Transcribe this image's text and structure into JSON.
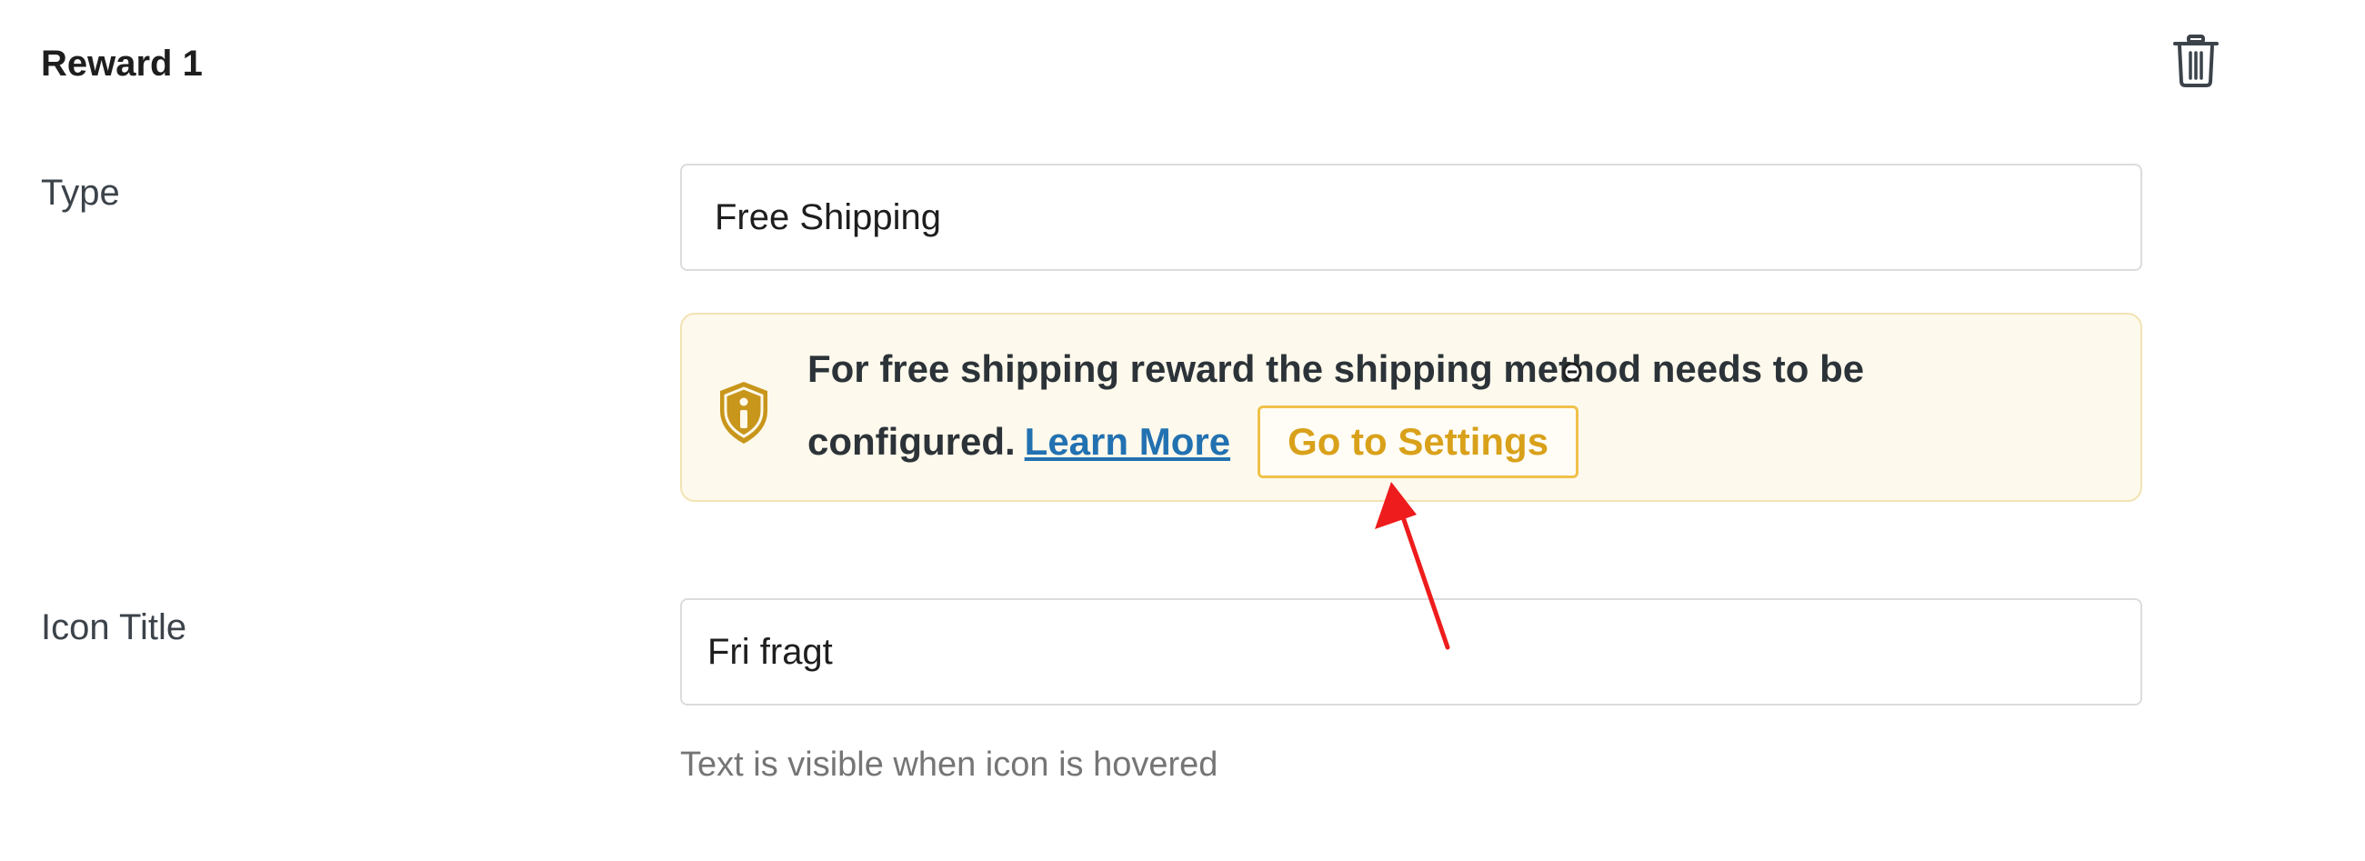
{
  "reward": {
    "title": "Reward 1"
  },
  "type_field": {
    "label": "Type",
    "value": "Free Shipping"
  },
  "notice": {
    "line1": "For free shipping reward the shipping method needs to be",
    "line2": "configured.",
    "learn_more": "Learn More",
    "go_to_settings": "Go to Settings"
  },
  "icon_title_field": {
    "label": "Icon Title",
    "value": "Fri fragt",
    "helper": "Text is visible when icon is hovered"
  },
  "icons": {
    "delete": "trash-icon",
    "notice": "shield-info-icon",
    "cursor": "mouse-cursor-icon",
    "annotation": "red-arrow-icon"
  },
  "colors": {
    "notice_background": "#fdf9ec",
    "notice_border": "#f2e3b3",
    "shield": "#c8961b",
    "link": "#2271b1",
    "settings_button_text": "#d9a11a",
    "settings_button_border": "#f0c14b",
    "annotation_arrow": "#ee1c1c"
  }
}
